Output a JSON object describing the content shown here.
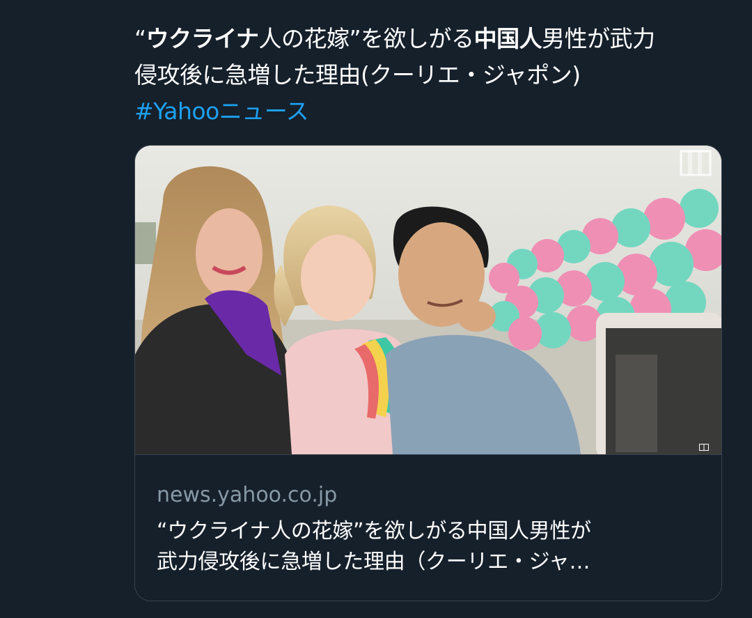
{
  "tweet": {
    "segments": [
      {
        "text": "“",
        "bold": false
      },
      {
        "text": "ウクライナ",
        "bold": true
      },
      {
        "text": "人の花嫁”を欲しがる",
        "bold": false
      },
      {
        "text": "中国人",
        "bold": true
      },
      {
        "text": "男性が武力侵攻後に急増した理由(クーリエ・ジャポン)",
        "bold": false
      }
    ],
    "line1_a": "“",
    "line1_b": "ウクライナ",
    "line1_c": "人の花嫁”を欲しがる",
    "line1_d": "中国人",
    "line1_e": "男性が武力",
    "line2": "侵攻後に急増した理由(クーリエ・ジャポン)",
    "hashtag": "#Yahooニュース"
  },
  "card": {
    "image_alt": "photo",
    "domain": "news.yahoo.co.jp",
    "title_line1": "“ウクライナ人の花嫁”を欲しがる中国人男性が",
    "title_line2": "武力侵攻後に急増した理由（クーリエ・ジャ…"
  },
  "icons": {
    "fullscreen": "fullscreen-icon",
    "image_corner": "image-badge-icon"
  },
  "colors": {
    "background": "#15202b",
    "text": "#ffffff",
    "link": "#1da1f2",
    "secondary": "#8899a6",
    "border": "#38444d"
  }
}
